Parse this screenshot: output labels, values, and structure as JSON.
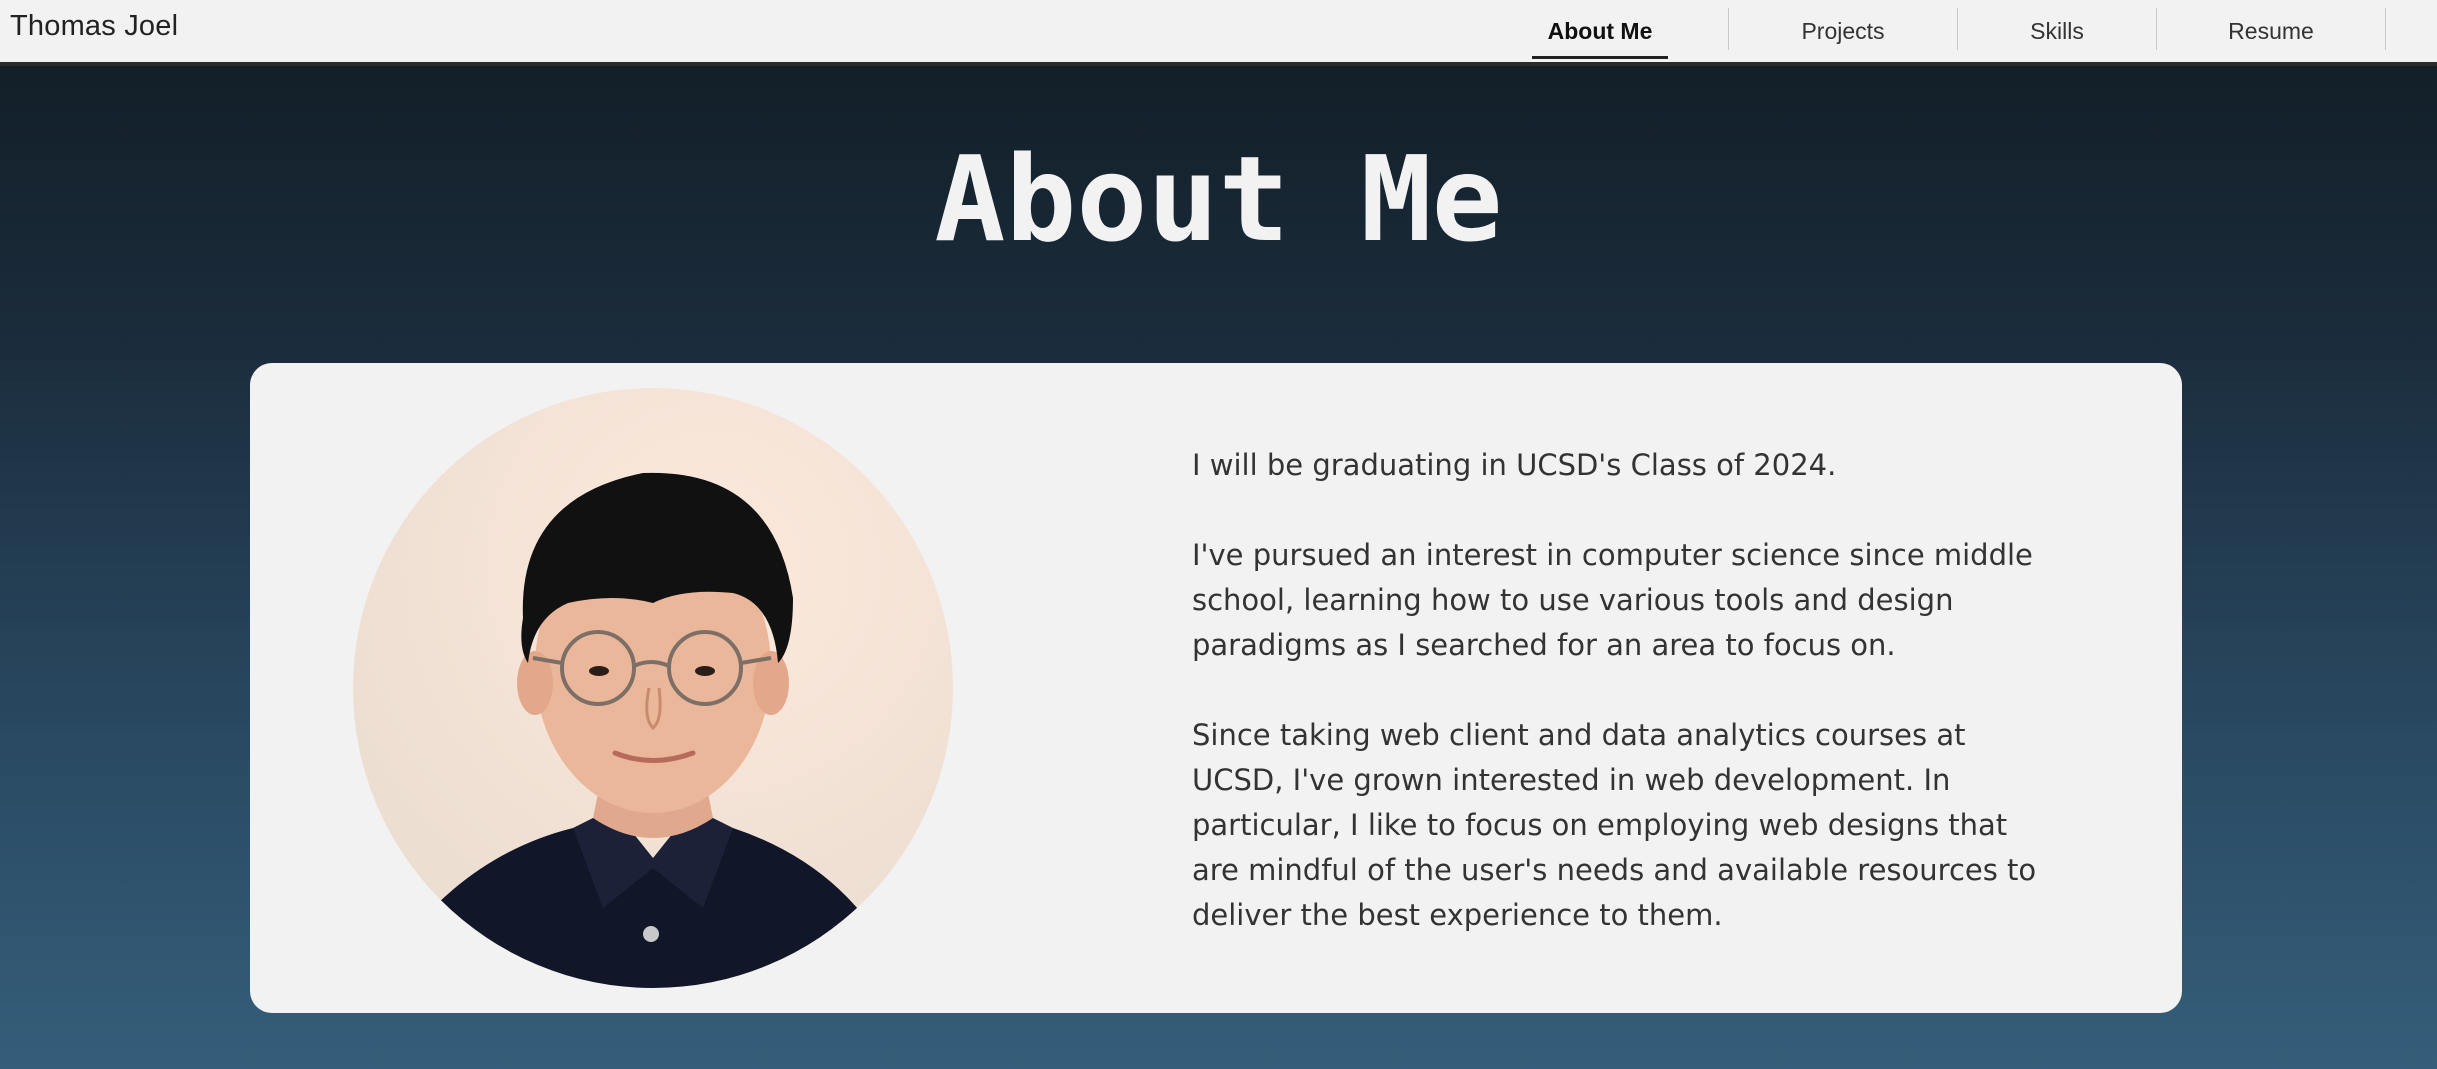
{
  "header": {
    "brand": "Thomas Joel",
    "nav": [
      {
        "label": "About Me",
        "active": true
      },
      {
        "label": "Projects",
        "active": false
      },
      {
        "label": "Skills",
        "active": false
      },
      {
        "label": "Resume",
        "active": false
      }
    ]
  },
  "main": {
    "title": "About Me",
    "bio": [
      "I will be graduating in UCSD's Class of 2024.",
      "I've pursued an interest in computer science since middle school, learning how to use various tools and design paradigms as I searched for an area to focus on.",
      "Since taking web client and data analytics courses at UCSD, I've grown interested in web development. In particular, I like to focus on employing web designs that are mindful of the user's needs and available resources to deliver the best experience to them."
    ]
  },
  "colors": {
    "topbar_bg": "#f2f2f2",
    "card_bg": "#f2f2f2",
    "gradient_top": "#111c24",
    "gradient_bottom": "#355e7a",
    "title_text": "#f2f2f2"
  },
  "icons": {
    "portrait": "profile-photo"
  }
}
